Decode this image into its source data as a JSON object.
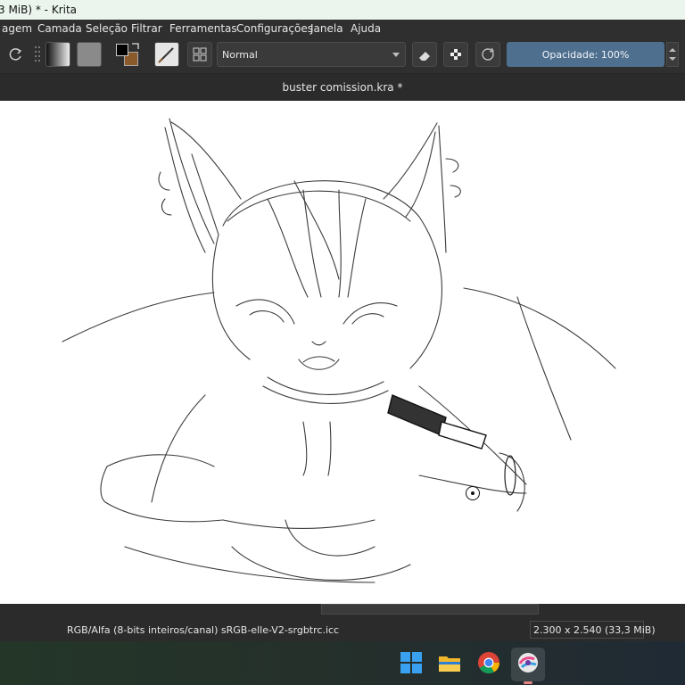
{
  "window": {
    "title": "3 MiB)  * - Krita"
  },
  "menu": {
    "items": [
      "agem",
      "Camada",
      "Seleção",
      "Filtrar",
      "Ferramentas",
      "Configurações",
      "Janela",
      "Ajuda"
    ]
  },
  "toolbar": {
    "blend_mode": "Normal",
    "opacity_label": "Opacidade: 100%",
    "fg_color": "#000000",
    "bg_color": "#8b5a2b"
  },
  "document": {
    "tab_title": "buster comission.kra *"
  },
  "status": {
    "color_info": "RGB/Alfa (8-bits inteiros/canal)  sRGB-elle-V2-srgbtrc.icc",
    "image_size": "2.300 x 2.540 (33,3 MiB)"
  },
  "taskbar": {
    "icons": [
      "windows-start-icon",
      "file-explorer-icon",
      "chrome-icon",
      "krita-icon"
    ]
  }
}
